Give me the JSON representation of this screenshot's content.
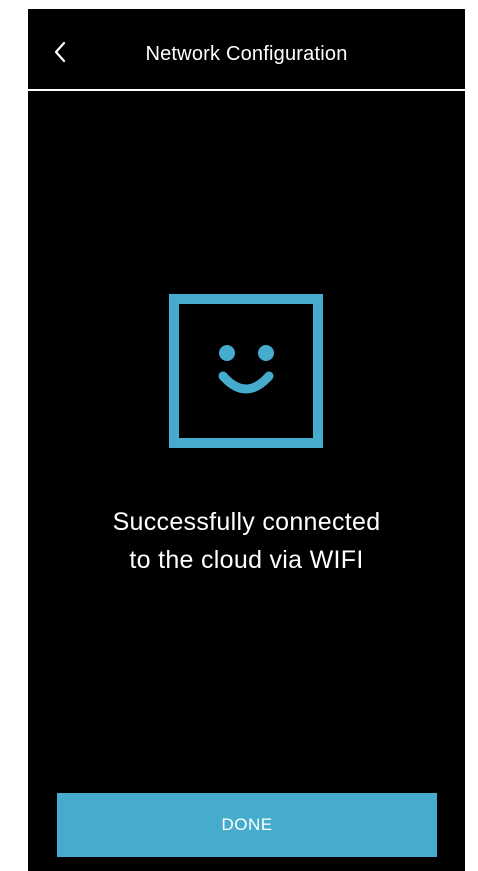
{
  "header": {
    "title": "Network Configuration",
    "back_icon": "chevron-left-icon"
  },
  "status": {
    "icon": "smiley-face-icon",
    "icon_color": "#45acce",
    "message_line1": "Successfully connected",
    "message_line2": "to the cloud via WIFI"
  },
  "footer": {
    "done_label": "DONE",
    "button_color": "#45acce"
  }
}
